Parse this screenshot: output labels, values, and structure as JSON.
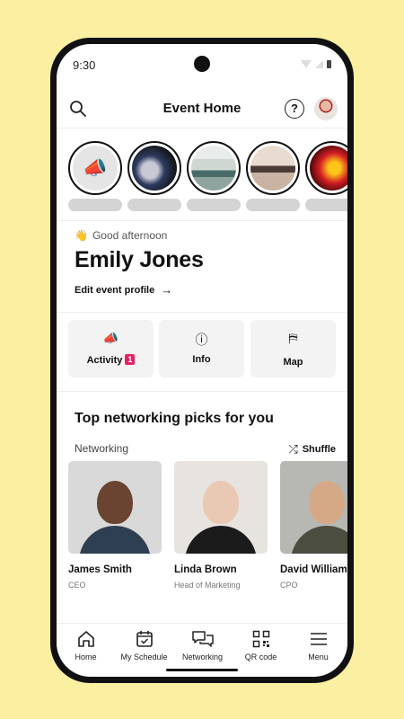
{
  "status_bar": {
    "time": "9:30"
  },
  "header": {
    "title": "Event Home",
    "help_symbol": "?"
  },
  "stories": [
    {
      "name": "announcement-story",
      "icon": "megaphone-icon"
    },
    {
      "name": "crowd-story",
      "colors": [
        "#2d3b60",
        "#c9c9d6"
      ]
    },
    {
      "name": "exhibit-story",
      "colors": [
        "#cfd7d2",
        "#4a6c69"
      ]
    },
    {
      "name": "meeting-story",
      "colors": [
        "#e8dcd0",
        "#4b3a35"
      ]
    },
    {
      "name": "concert-story",
      "colors": [
        "#d21c23",
        "#ffc41a"
      ]
    }
  ],
  "welcome": {
    "greeting": "Good afternoon",
    "name": "Emily Jones",
    "edit_link": "Edit event profile",
    "arrow": "→"
  },
  "quick_actions": [
    {
      "label": "Activity",
      "icon": "megaphone-icon",
      "glyph": "📣",
      "badge": "1"
    },
    {
      "label": "Info",
      "icon": "info-icon",
      "glyph": "ⓘ"
    },
    {
      "label": "Map",
      "icon": "signpost-icon",
      "glyph": "⛿"
    }
  ],
  "networking": {
    "title": "Top networking picks for you",
    "subtitle": "Networking",
    "shuffle_label": "Shuffle",
    "shuffle_glyph": "⤮",
    "people": [
      {
        "name": "James Smith",
        "role": "CEO",
        "bg": "#d9d9d9",
        "skin": "#6b4331",
        "clothes": "#2f3f52"
      },
      {
        "name": "Linda Brown",
        "role": "Head of Marketing",
        "bg": "#e7e3df",
        "skin": "#e9c9b4",
        "clothes": "#1b1b1b"
      },
      {
        "name": "David Williams",
        "role": "CPO",
        "bg": "#b7b7b3",
        "skin": "#d6a986",
        "clothes": "#4a4d3f"
      }
    ]
  },
  "bottom_nav": [
    {
      "label": "Home",
      "icon": "home-icon"
    },
    {
      "label": "My Schedule",
      "icon": "calendar-icon"
    },
    {
      "label": "Networking",
      "icon": "chat-icon"
    },
    {
      "label": "QR code",
      "icon": "qr-code-icon"
    },
    {
      "label": "Menu",
      "icon": "menu-icon"
    }
  ],
  "colors": {
    "accent": "#ec1f5f",
    "background": "#fbf0a1"
  }
}
